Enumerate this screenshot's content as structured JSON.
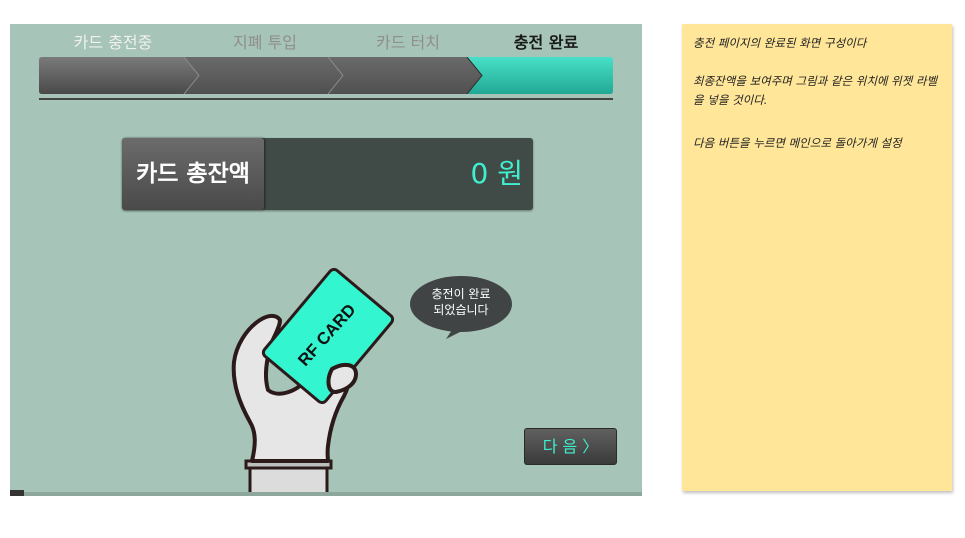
{
  "steps": [
    {
      "label": "카드 충전중",
      "state": "done"
    },
    {
      "label": "지폐 투입",
      "state": "pending"
    },
    {
      "label": "카드 터치",
      "state": "pending"
    },
    {
      "label": "충전 완료",
      "state": "active"
    }
  ],
  "balance": {
    "label": "카드 총잔액",
    "value": "0 원"
  },
  "card": {
    "text": "RF CARD"
  },
  "bubble": {
    "line1": "충전이 완료",
    "line2": "되었습니다"
  },
  "next_button": {
    "label": "다 음 〉"
  },
  "memo": {
    "line1": "충전 페이지의 완료된 화면 구성이다",
    "line2": "최종잔액을 보여주며 그림과 같은 위치에 위젯 라벨을 넣을 것이다.",
    "line3": "다음 버튼을 누르면 메인으로 돌아가게  설정"
  },
  "colors": {
    "screen_bg": "#a6c4b8",
    "accent": "#3ff0cf",
    "step_done": "#5a5a5a",
    "step_active": "#33c9b3",
    "memo_bg": "#ffe699"
  }
}
